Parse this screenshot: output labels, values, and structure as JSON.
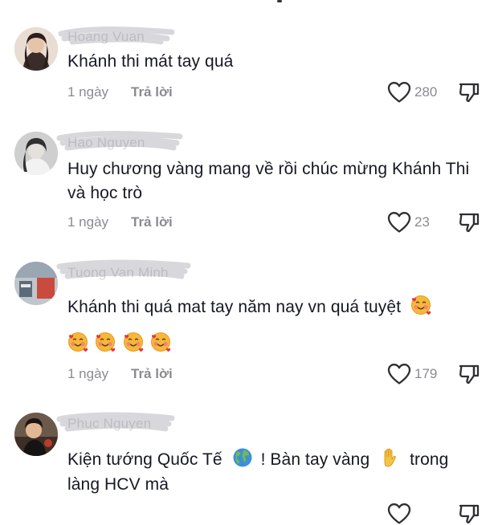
{
  "comments": [
    {
      "username": "Hoang Vuan",
      "text": "Khánh thi mát tay quá",
      "time": "1 ngày",
      "reply_label": "Trả lời",
      "likes": "280",
      "avatar_icon": "user-avatar-photo"
    },
    {
      "username": "Hao Nguyen",
      "text": "Huy chương vàng mang về rồi chúc mừng Khánh Thi và học trò",
      "time": "1 ngày",
      "reply_label": "Trả lời",
      "likes": "23",
      "avatar_icon": "user-avatar-photo"
    },
    {
      "username": "Tuong Van Minh",
      "text": "Khánh thi quá mat tay năm nay vn quá tuyệt",
      "time": "1 ngày",
      "reply_label": "Trả lời",
      "likes": "179",
      "avatar_icon": "user-avatar-photo",
      "emoji_inline": "smiling-face-with-hearts",
      "emoji_row": [
        "smiling-face-with-hearts",
        "smiling-face-with-hearts",
        "smiling-face-with-hearts",
        "smiling-face-with-hearts"
      ]
    },
    {
      "username": "Phuc Nguyen",
      "text_part1": "Kiện tướng Quốc Tế",
      "text_part2": "! Bàn tay vàng",
      "text_part3": "trong",
      "text_line2": "làng HCV mà",
      "avatar_icon": "user-avatar-photo",
      "emoji_globe": "globe-icon",
      "emoji_hand": "raised-hand-icon"
    }
  ],
  "colors": {
    "text": "#161823",
    "secondary": "#8a8b91",
    "background": "#ffffff",
    "scribble": "#d8d8dc"
  },
  "icons": {
    "like": "heart-outline-icon",
    "dislike": "thumbs-down-outline-icon"
  }
}
